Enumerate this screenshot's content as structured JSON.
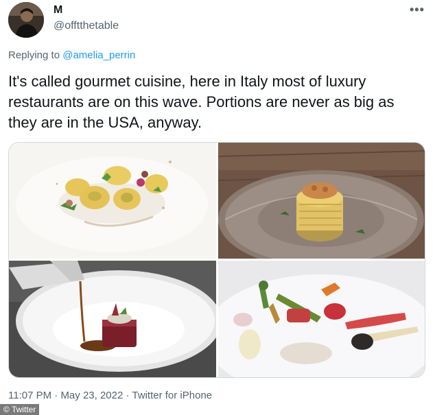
{
  "author": {
    "display_name": "M",
    "handle": "@offtthetable"
  },
  "more_icon": "more-horizontal-icon",
  "reply": {
    "prefix": "Replying to ",
    "mention": "@amelia_perrin"
  },
  "tweet_text": "It's called gourmet cuisine, here in Italy most of luxury restaurants are on this wave. Portions are never as big as they are in the USA, anyway.",
  "media_count": 4,
  "meta": {
    "time": "11:07 PM",
    "separator1": " · ",
    "date": "May 23, 2022",
    "separator2": " · ",
    "source": "Twitter for iPhone"
  },
  "watermark": "© Twitter",
  "colors": {
    "link": "#1d9bf0",
    "secondary_text": "#536471",
    "primary_text": "#0f1419"
  }
}
